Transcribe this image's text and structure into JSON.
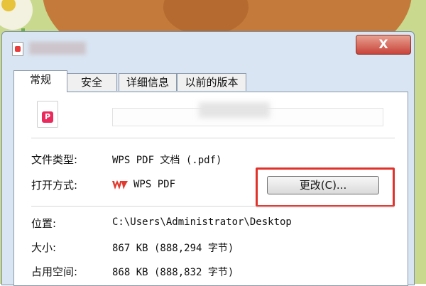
{
  "window": {
    "close_label": "X"
  },
  "tabs": [
    {
      "label": "常规",
      "active": true
    },
    {
      "label": "安全",
      "active": false
    },
    {
      "label": "详细信息",
      "active": false
    },
    {
      "label": "以前的版本",
      "active": false
    }
  ],
  "file": {
    "icon_badge": "P"
  },
  "properties": {
    "file_type_label": "文件类型:",
    "file_type_value": "WPS PDF 文档 (.pdf)",
    "open_with_label": "打开方式:",
    "open_with_value": "WPS PDF",
    "change_button": "更改(C)...",
    "location_label": "位置:",
    "location_value": "C:\\Users\\Administrator\\Desktop",
    "size_label": "大小:",
    "size_value": "867 KB (888,294 字节)",
    "disk_size_label": "占用空间:",
    "disk_size_value": "868 KB (888,832 字节)"
  },
  "colors": {
    "highlight": "#e0322a",
    "wps_logo": "#e23a2e",
    "pdf_badge": "#ea2a5c"
  }
}
